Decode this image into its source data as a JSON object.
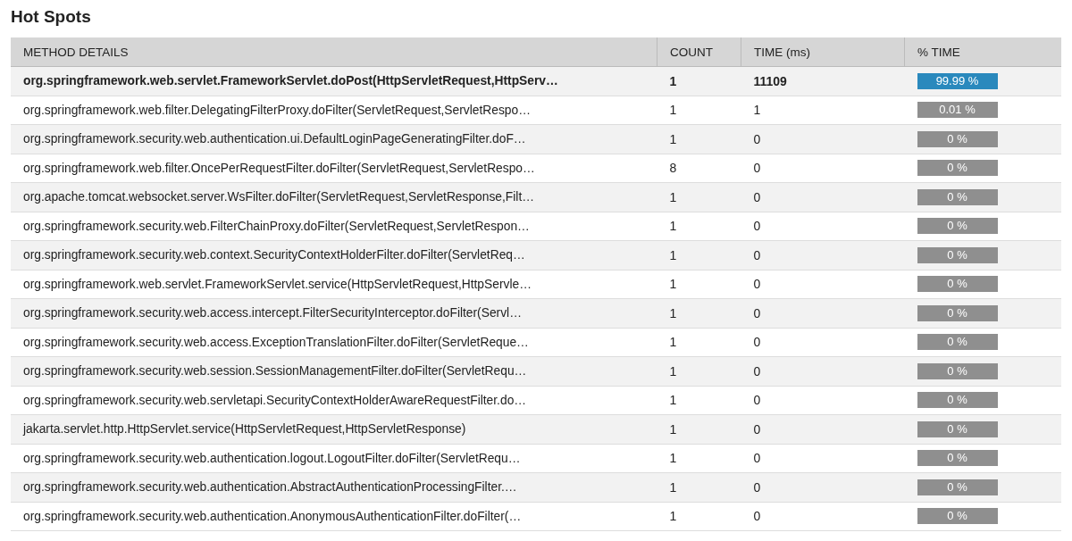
{
  "title": "Hot Spots",
  "table": {
    "columns": [
      "METHOD DETAILS",
      "COUNT",
      "TIME (ms)",
      "% TIME"
    ],
    "rows": [
      {
        "method": "org.springframework.web.servlet.FrameworkServlet.doPost(HttpServletRequest,HttpServ…",
        "count": "1",
        "time": "11109",
        "percent": "99.99 %",
        "highlighted": true
      },
      {
        "method": "org.springframework.web.filter.DelegatingFilterProxy.doFilter(ServletRequest,ServletRespo…",
        "count": "1",
        "time": "1",
        "percent": "0.01 %",
        "highlighted": false
      },
      {
        "method": "org.springframework.security.web.authentication.ui.DefaultLoginPageGeneratingFilter.doF…",
        "count": "1",
        "time": "0",
        "percent": "0 %",
        "highlighted": false
      },
      {
        "method": "org.springframework.web.filter.OncePerRequestFilter.doFilter(ServletRequest,ServletRespo…",
        "count": "8",
        "time": "0",
        "percent": "0 %",
        "highlighted": false
      },
      {
        "method": "org.apache.tomcat.websocket.server.WsFilter.doFilter(ServletRequest,ServletResponse,Filt…",
        "count": "1",
        "time": "0",
        "percent": "0 %",
        "highlighted": false
      },
      {
        "method": "org.springframework.security.web.FilterChainProxy.doFilter(ServletRequest,ServletRespon…",
        "count": "1",
        "time": "0",
        "percent": "0 %",
        "highlighted": false
      },
      {
        "method": "org.springframework.security.web.context.SecurityContextHolderFilter.doFilter(ServletReq…",
        "count": "1",
        "time": "0",
        "percent": "0 %",
        "highlighted": false
      },
      {
        "method": "org.springframework.web.servlet.FrameworkServlet.service(HttpServletRequest,HttpServle…",
        "count": "1",
        "time": "0",
        "percent": "0 %",
        "highlighted": false
      },
      {
        "method": "org.springframework.security.web.access.intercept.FilterSecurityInterceptor.doFilter(Servl…",
        "count": "1",
        "time": "0",
        "percent": "0 %",
        "highlighted": false
      },
      {
        "method": "org.springframework.security.web.access.ExceptionTranslationFilter.doFilter(ServletReque…",
        "count": "1",
        "time": "0",
        "percent": "0 %",
        "highlighted": false
      },
      {
        "method": "org.springframework.security.web.session.SessionManagementFilter.doFilter(ServletRequ…",
        "count": "1",
        "time": "0",
        "percent": "0 %",
        "highlighted": false
      },
      {
        "method": "org.springframework.security.web.servletapi.SecurityContextHolderAwareRequestFilter.do…",
        "count": "1",
        "time": "0",
        "percent": "0 %",
        "highlighted": false
      },
      {
        "method": "jakarta.servlet.http.HttpServlet.service(HttpServletRequest,HttpServletResponse)",
        "count": "1",
        "time": "0",
        "percent": "0 %",
        "highlighted": false
      },
      {
        "method": "org.springframework.security.web.authentication.logout.LogoutFilter.doFilter(ServletRequ…",
        "count": "1",
        "time": "0",
        "percent": "0 %",
        "highlighted": false
      },
      {
        "method": "org.springframework.security.web.authentication.AbstractAuthenticationProcessingFilter.…",
        "count": "1",
        "time": "0",
        "percent": "0 %",
        "highlighted": false
      },
      {
        "method": "org.springframework.security.web.authentication.AnonymousAuthenticationFilter.doFilter(…",
        "count": "1",
        "time": "0",
        "percent": "0 %",
        "highlighted": false
      }
    ]
  }
}
